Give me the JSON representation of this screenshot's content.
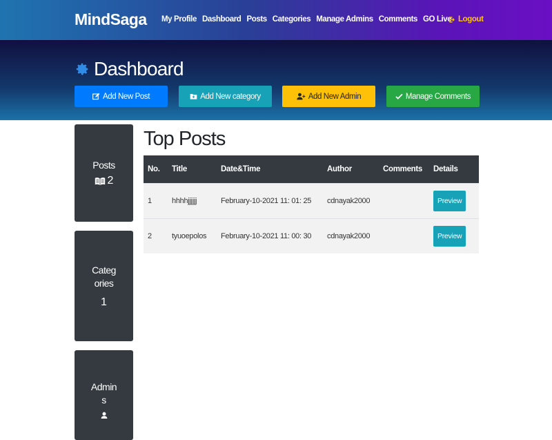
{
  "navbar": {
    "brand": "MindSaga",
    "links": [
      "My Profile",
      "Dashboard",
      "Posts",
      "Categories",
      "Manage Admins",
      "Comments",
      "GO Live"
    ],
    "logout": "Logout"
  },
  "header": {
    "title": "Dashboard",
    "icon": "gear-icon",
    "buttons": {
      "add_post": "Add New Post",
      "add_category": "Add New category",
      "add_admin": "Add New Admin",
      "manage_comments": "Manage Comments"
    }
  },
  "stats": {
    "posts": {
      "label": "Posts",
      "value": "2"
    },
    "categories": {
      "label": "Categories",
      "value": "1"
    },
    "admins": {
      "label": "Admins"
    }
  },
  "top_posts": {
    "title": "Top Posts",
    "columns": [
      "No.",
      "Title",
      "Date&Time",
      "Author",
      "Comments",
      "Details"
    ],
    "rows": [
      {
        "no": "1",
        "title": "hhhhjjjjjj",
        "datetime": "February-10-2021 11: 01: 25",
        "author": "cdnayak2000",
        "comments": "",
        "details": "Preview"
      },
      {
        "no": "2",
        "title": "tyuoepolos",
        "datetime": "February-10-2021 11: 00: 30",
        "author": "cdnayak2000",
        "comments": "",
        "details": "Preview"
      }
    ]
  },
  "colors": {
    "primary": "#007bff",
    "info": "#17a2b8",
    "warning": "#ffc107",
    "success": "#28a745",
    "dark": "#343a40"
  }
}
